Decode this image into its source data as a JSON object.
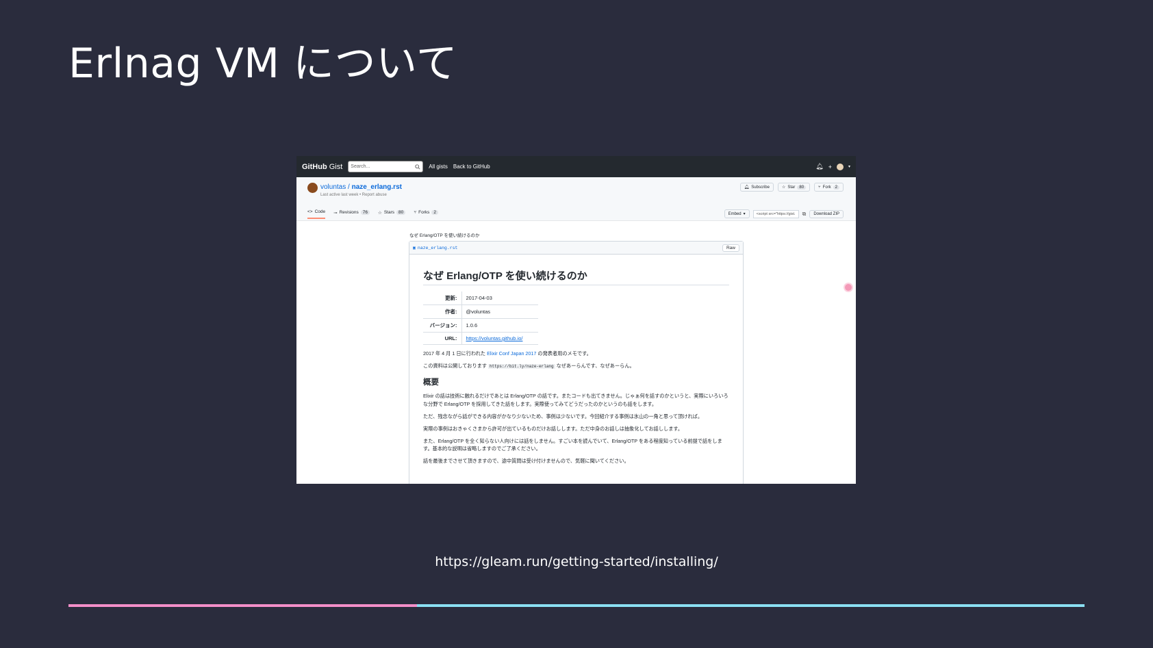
{
  "slide": {
    "title": "Erlnag VM について",
    "url_caption": "https://gleam.run/getting-started/installing/",
    "accent_colors": {
      "background": "#2a2c3d",
      "bar_left": "#f48fc9",
      "bar_right": "#8be0f3"
    }
  },
  "screenshot": {
    "header": {
      "logo_bold": "GitHub",
      "logo_rest": " Gist",
      "search_placeholder": "Search...",
      "nav_all_gists": "All gists",
      "nav_back": "Back to GitHub",
      "icons": [
        "bell-icon",
        "plus-icon",
        "avatar-icon"
      ]
    },
    "repo": {
      "owner": "voluntas",
      "separator": " / ",
      "name": "naze_erlang.rst",
      "sub": "Last active last week • Report abuse",
      "actions": {
        "subscribe": "Subscribe",
        "star": "Star",
        "star_count": "80",
        "fork": "Fork",
        "fork_count": "2"
      },
      "tabs": [
        {
          "label": "Code",
          "count": ""
        },
        {
          "label": "Revisions",
          "count": "76"
        },
        {
          "label": "Stars",
          "count": "80"
        },
        {
          "label": "Forks",
          "count": "2"
        }
      ],
      "embed_label": "Embed",
      "embed_value": "<script src=\"https://gist.",
      "download": "Download ZIP"
    },
    "gist": {
      "description": "なぜ Erlang/OTP を使い続けるのか",
      "file_name": "naze_erlang.rst",
      "raw_label": "Raw",
      "doc_title": "なぜ Erlang/OTP を使い続けるのか",
      "meta": [
        {
          "key": "更新:",
          "value": "2017-04-03",
          "link": false
        },
        {
          "key": "作者:",
          "value": "@voluntas",
          "link": false
        },
        {
          "key": "バージョン:",
          "value": "1.0.6",
          "link": false
        },
        {
          "key": "URL:",
          "value": "https://voluntas.github.io/",
          "link": true
        }
      ],
      "intro1_pre": "2017 年 4 月 1 日に行われた ",
      "intro1_link": "Elixir Conf Japan 2017",
      "intro1_post": " の発表者用のメモです。",
      "intro2_pre": "この資料は公開しております ",
      "intro2_code": "https://bit.ly/naze-erlang",
      "intro2_post": " なぜあーらんです、なぜあーらん。",
      "section_heading": "概要",
      "paragraphs": [
        "Elixir の話は技術に触れるだけであとは Erlang/OTP の話です。またコードも出てきません。じゃぁ何を話すのかというと、実際にいろいろな分野で Erlang/OTP を採用してきた話をします。実際使ってみてどうだったのかというのも話をします。",
        "ただ、残念ながら話ができる内容がかなり少ないため、事例は少ないです。今回紹介する事例は氷山の一角と思って頂ければ。",
        "実際の事例はおきゃくさまから許可が出ているものだけお話しします。ただ中身のお話しは抽象化してお話しします。",
        "また、Erlang/OTP を全く知らない人向けには話をしません。すごい本を読んでいて、Erlang/OTP をある程度知っている前提で話をします。基本的な説明は省略しますのでご了承ください。",
        "話を最後までさせて頂きますので、途中質問は受け付けませんので、気軽に聞いてください。"
      ]
    }
  }
}
